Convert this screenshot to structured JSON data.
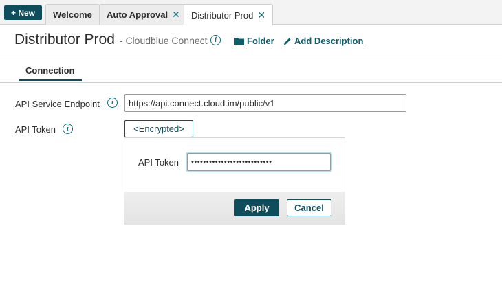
{
  "toolbar": {
    "new_label": "+ New"
  },
  "tabs": [
    {
      "label": "Welcome"
    },
    {
      "label": "Auto Approval",
      "close": "✕"
    },
    {
      "label": "Distributor Prod",
      "close": "✕"
    }
  ],
  "header": {
    "title": "Distributor Prod",
    "subtitle": "- Cloudblue Connect",
    "info": "i",
    "folder_label": "Folder",
    "add_description_label": "Add Description"
  },
  "subtabs": [
    {
      "label": "Connection"
    }
  ],
  "form": {
    "endpoint_label": "API Service Endpoint",
    "endpoint_value": "https://api.connect.cloud.im/public/v1",
    "token_label": "API Token",
    "token_button": "<Encrypted>",
    "info": "i"
  },
  "popup": {
    "label": "API Token",
    "value": "•••••••••••••••••••••••••••",
    "apply_label": "Apply",
    "cancel_label": "Cancel"
  },
  "icons": {
    "folder": "folder-icon",
    "pencil": "pencil-icon",
    "info": "info-icon",
    "close": "close-icon"
  },
  "colors": {
    "accent": "#0e4d5c",
    "link": "#0e5f6e"
  }
}
